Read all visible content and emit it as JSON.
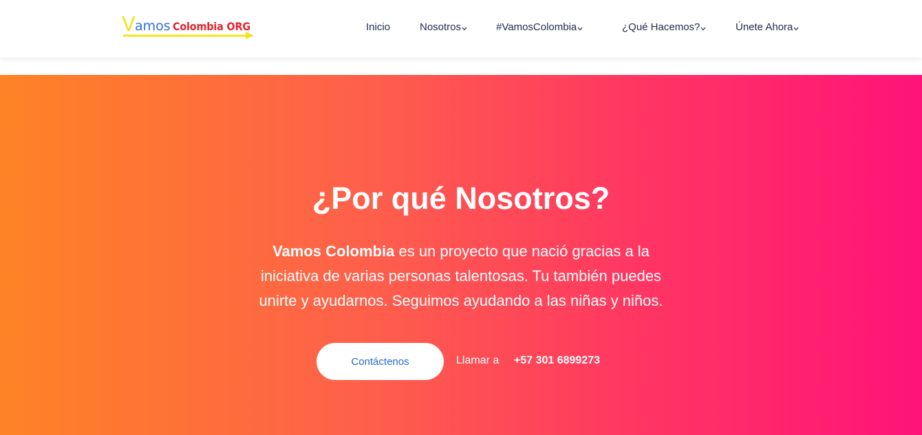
{
  "logo": {
    "v": "V",
    "amos": "amos",
    "org": "Colombia ORG"
  },
  "nav": {
    "items": [
      {
        "label": "Inicio",
        "dropdown": false
      },
      {
        "label": "Nosotros",
        "dropdown": true
      },
      {
        "label": "#VamosColombia",
        "dropdown": true
      },
      {
        "label": "¿Qué Hacemos?",
        "dropdown": true
      },
      {
        "label": "Únete Ahora",
        "dropdown": true
      }
    ]
  },
  "hero": {
    "title": "¿Por qué Nosotros?",
    "text_bold": "Vamos Colombia",
    "text_rest": " es un proyecto que nació gracias a la iniciativa de varias personas talentosas. Tu también puedes unirte y ayudarnos. Seguimos ayudando a las niñas y niños.",
    "button_label": "Contáctenos",
    "call_label": "Llamar a",
    "phone": "+57 301 6899273"
  },
  "colors": {
    "gradient_start": "#fe8325",
    "gradient_end": "#ff1379",
    "nav_text": "#1d2a4a",
    "button_text": "#2a6ac8"
  }
}
